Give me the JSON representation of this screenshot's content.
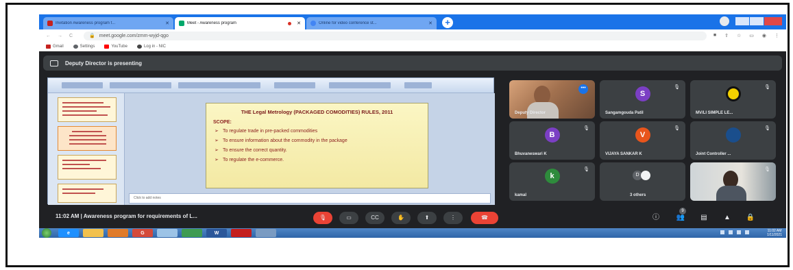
{
  "browser": {
    "tabs": [
      {
        "label": "Invitation Awareness program f...",
        "active": false
      },
      {
        "label": "Meet - Awareness program",
        "active": true,
        "recording": true
      },
      {
        "label": "Online for video conference st...",
        "active": false
      }
    ],
    "newtab_label": "+",
    "url": "meet.google.com/zmm-wyjd-qgo",
    "bookmarks": [
      "Gmail",
      "Settings",
      "YouTube",
      "Log in - NIC"
    ]
  },
  "meet": {
    "presenting_banner": "Deputy Director is presenting",
    "slide": {
      "title": "THE Legal Metrology (PACKAGED COMODITIES) RULES, 2011",
      "scope_label": "SCOPE:",
      "bullets": [
        "To regulate trade in pre-packed commodities",
        "To ensure information about the commodity in the package",
        "To ensure the correct quantity.",
        "To regulate the e-commerce."
      ],
      "notes_placeholder": "Click to add notes"
    },
    "participants": [
      {
        "name": "Deputy Director",
        "type": "video"
      },
      {
        "name": "Sangamgouda Patil",
        "initial": "S",
        "color": "#7b3fc4"
      },
      {
        "name": "MV/LI SIMPLE LE...",
        "type": "logo"
      },
      {
        "name": "Bhuvaneswari K",
        "initial": "B",
        "color": "#7b3fc4"
      },
      {
        "name": "VIJAYA SANKAR K",
        "initial": "V",
        "color": "#e8551c"
      },
      {
        "name": "Joint Controller ...",
        "type": "logo2"
      },
      {
        "name": "kamal",
        "initial": "k",
        "color": "#2e8b3c"
      },
      {
        "name": "3 others",
        "initial": "D",
        "type": "others"
      },
      {
        "name": "",
        "type": "video2"
      }
    ],
    "meeting_info": "11:02 AM  |  Awareness program for requirements of L...",
    "participant_count": "9",
    "accent_red": "#ea4335"
  },
  "taskbar": {
    "apps": [
      "e",
      "",
      "",
      "G",
      "",
      "",
      "W",
      "",
      ""
    ],
    "clock_time": "11:02 AM",
    "clock_date": "1/11/2021"
  }
}
